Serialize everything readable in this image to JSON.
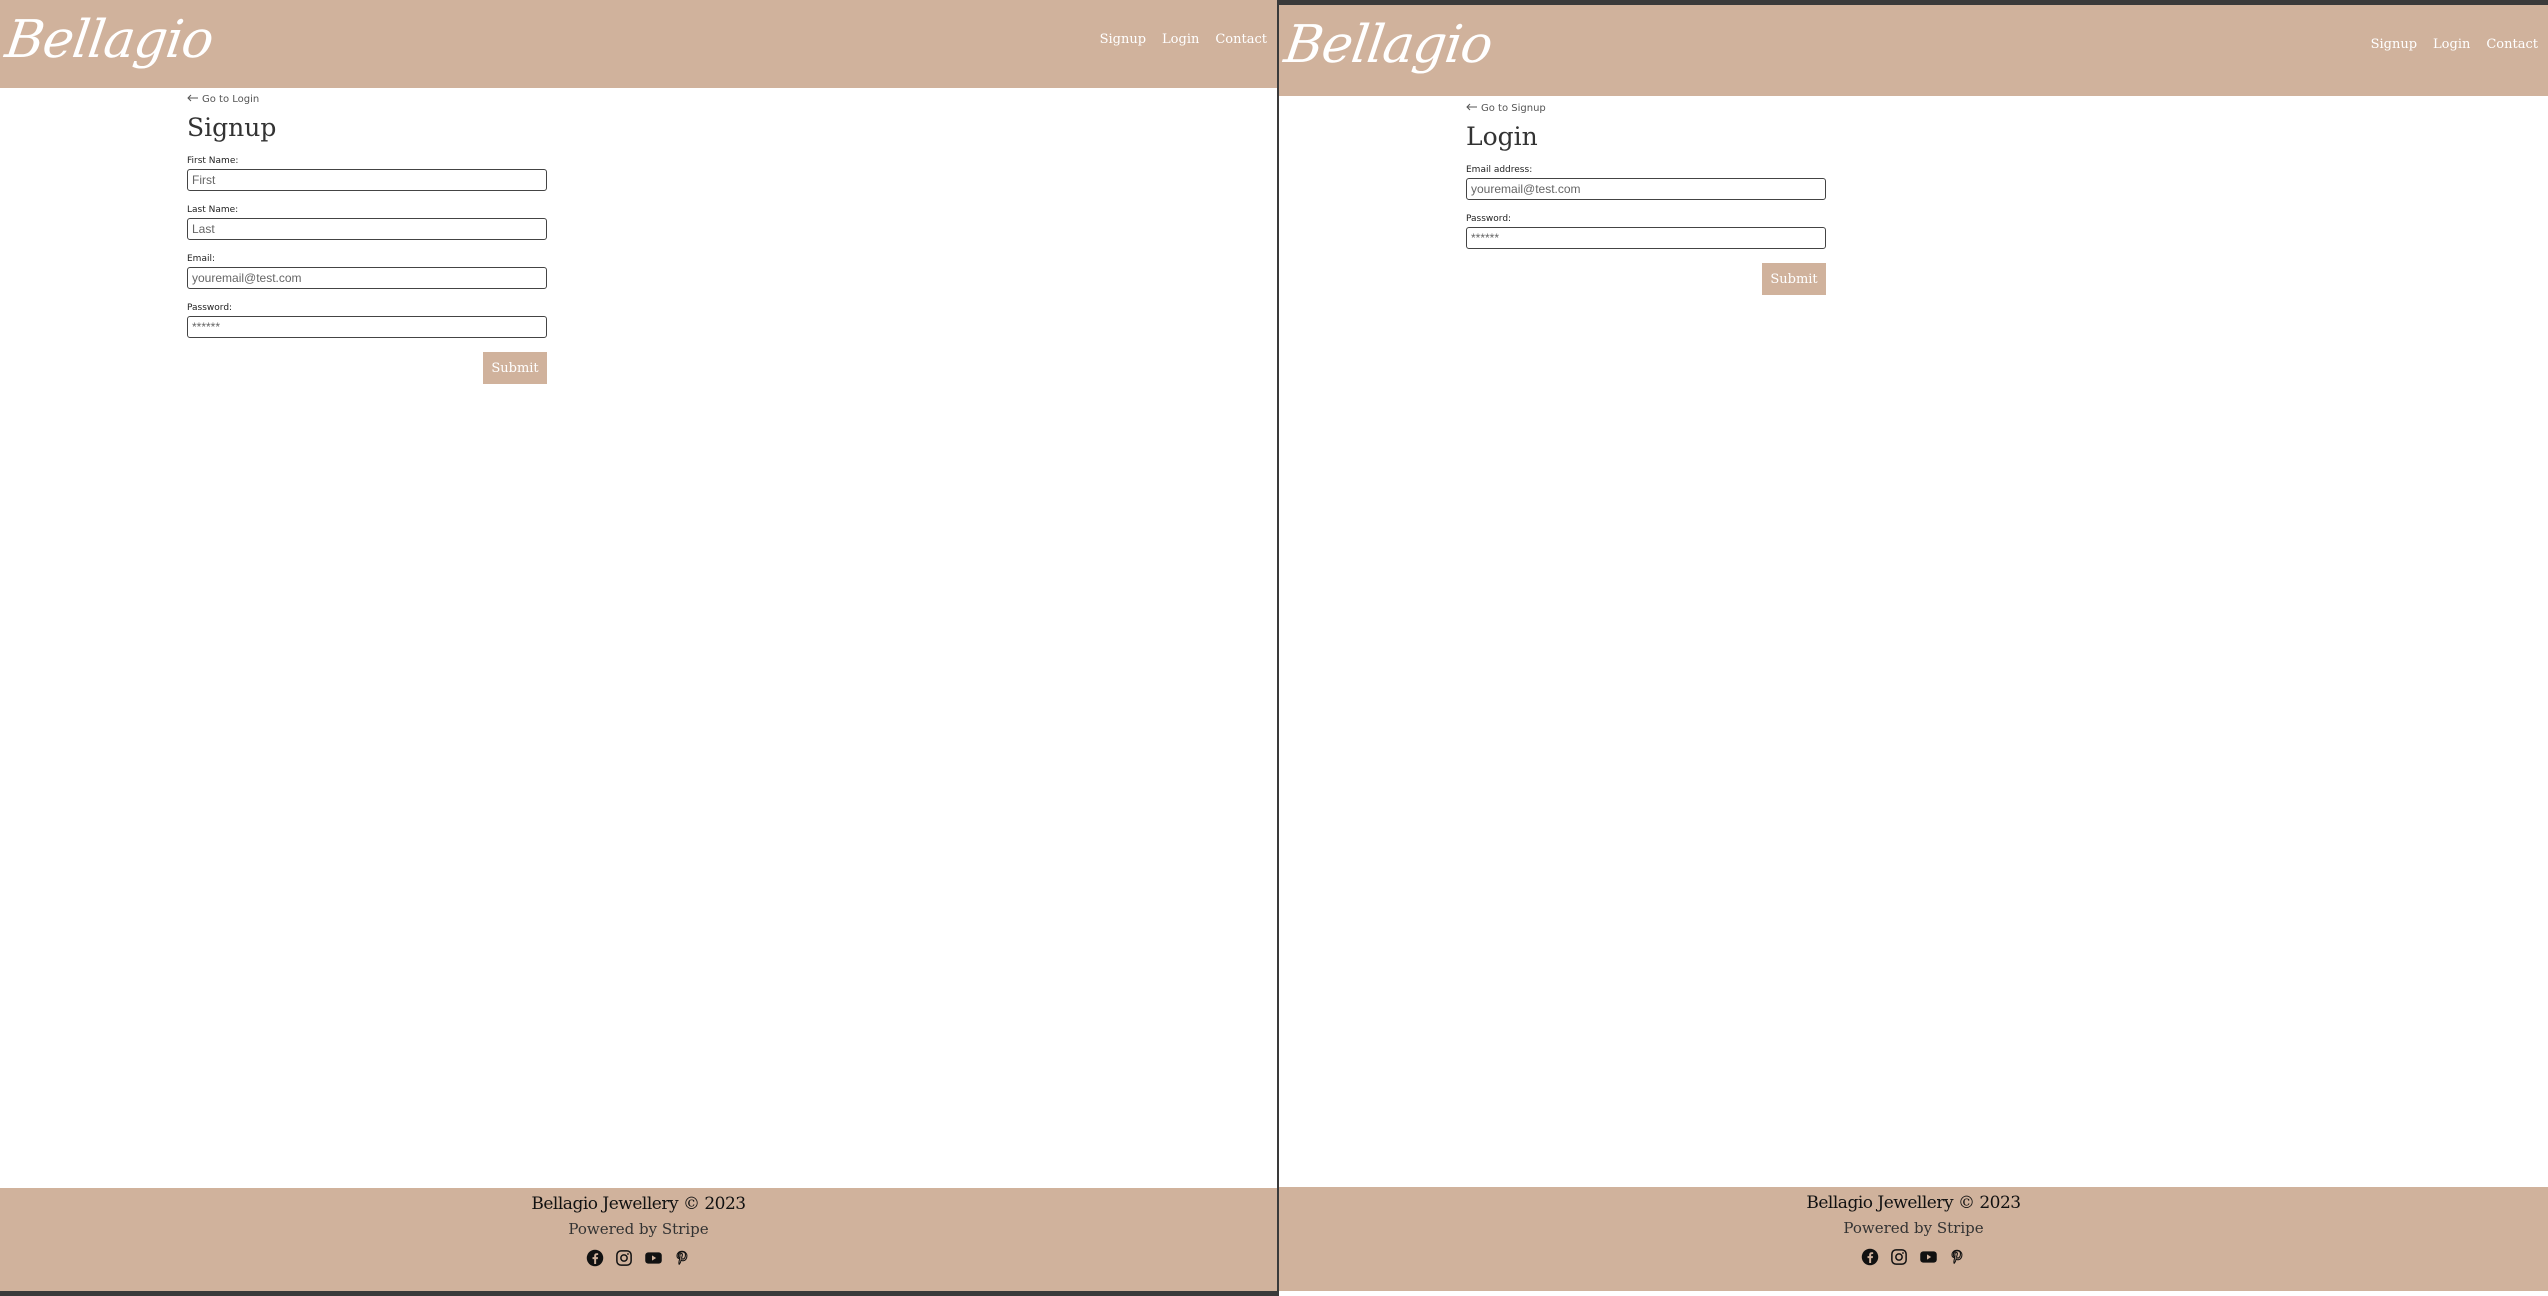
{
  "signup_page": {
    "header": {
      "logo": "Bellagio",
      "nav": [
        "Signup",
        "Login",
        "Contact"
      ]
    },
    "back_link": "Go to Login",
    "title": "Signup",
    "fields": [
      {
        "label": "First Name:",
        "placeholder": "First",
        "value": ""
      },
      {
        "label": "Last Name:",
        "placeholder": "Last",
        "value": ""
      },
      {
        "label": "Email:",
        "placeholder": "youremail@test.com",
        "value": ""
      },
      {
        "label": "Password:",
        "placeholder": "******",
        "value": ""
      }
    ],
    "submit_label": "Submit",
    "footer": {
      "title": "Bellagio Jewellery © 2023",
      "powered": "Powered by Stripe",
      "icons": [
        "facebook-icon",
        "instagram-icon",
        "youtube-icon",
        "pinterest-icon"
      ]
    }
  },
  "login_page": {
    "header": {
      "logo": "Bellagio",
      "nav": [
        "Signup",
        "Login",
        "Contact"
      ]
    },
    "back_link": "Go to Signup",
    "title": "Login",
    "fields": [
      {
        "label": "Email address:",
        "placeholder": "youremail@test.com",
        "value": ""
      },
      {
        "label": "Password:",
        "placeholder": "******",
        "value": ""
      }
    ],
    "submit_label": "Submit",
    "footer": {
      "title": "Bellagio Jewellery © 2023",
      "powered": "Powered by Stripe",
      "icons": [
        "facebook-icon",
        "instagram-icon",
        "youtube-icon",
        "pinterest-icon"
      ]
    }
  },
  "colors": {
    "brand": "#d0b29c",
    "divider": "#3a3a3a"
  }
}
